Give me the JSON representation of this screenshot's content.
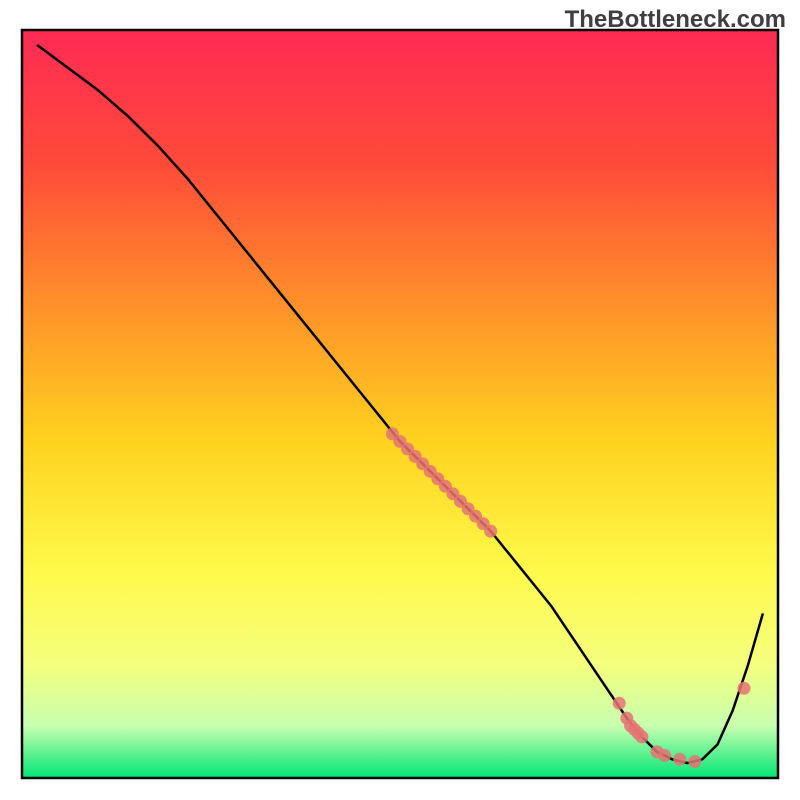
{
  "watermark": "TheBottleneck.com",
  "chart_data": {
    "type": "line",
    "title": "",
    "xlabel": "",
    "ylabel": "",
    "xlim": [
      0,
      100
    ],
    "ylim": [
      0,
      100
    ],
    "background_gradient": {
      "stops": [
        {
          "offset": 0.0,
          "color": "#ff2a55"
        },
        {
          "offset": 0.18,
          "color": "#ff4b3a"
        },
        {
          "offset": 0.35,
          "color": "#ff8a2b"
        },
        {
          "offset": 0.55,
          "color": "#ffd21f"
        },
        {
          "offset": 0.72,
          "color": "#fff94a"
        },
        {
          "offset": 0.85,
          "color": "#f4ff7e"
        },
        {
          "offset": 0.93,
          "color": "#c8ffb0"
        },
        {
          "offset": 1.0,
          "color": "#00e676"
        }
      ]
    },
    "series": [
      {
        "name": "bottleneck-curve",
        "color": "#000000",
        "x": [
          2,
          6,
          10,
          14,
          18,
          22,
          26,
          30,
          34,
          38,
          42,
          46,
          50,
          54,
          56,
          58,
          60,
          62,
          64,
          66,
          68,
          70,
          72,
          74,
          76,
          78,
          80,
          82,
          84,
          86,
          88,
          90,
          92,
          94,
          96,
          98
        ],
        "y": [
          98,
          95,
          92,
          88.5,
          84.5,
          80,
          75,
          70,
          65,
          60,
          55,
          50,
          45,
          41,
          39,
          37,
          35,
          33,
          30.5,
          28,
          25.5,
          23,
          20,
          17,
          14,
          11,
          8,
          5.5,
          3.5,
          2.5,
          2,
          2.5,
          4.5,
          9,
          15,
          22
        ]
      }
    ],
    "marker_points": {
      "name": "highlighted-points",
      "color": "#e57373",
      "x": [
        49,
        50,
        51,
        52,
        53,
        54,
        55,
        56,
        57,
        58,
        59,
        60,
        61,
        62,
        79,
        80,
        80.5,
        81,
        81.5,
        82,
        84,
        85,
        87,
        89,
        95.5
      ],
      "y": [
        46,
        45,
        44,
        43,
        42,
        41,
        40,
        39,
        38,
        37,
        36,
        35,
        34,
        33,
        10,
        8,
        7,
        6.5,
        6,
        5.5,
        3.5,
        3,
        2.5,
        2.2,
        12
      ]
    }
  }
}
